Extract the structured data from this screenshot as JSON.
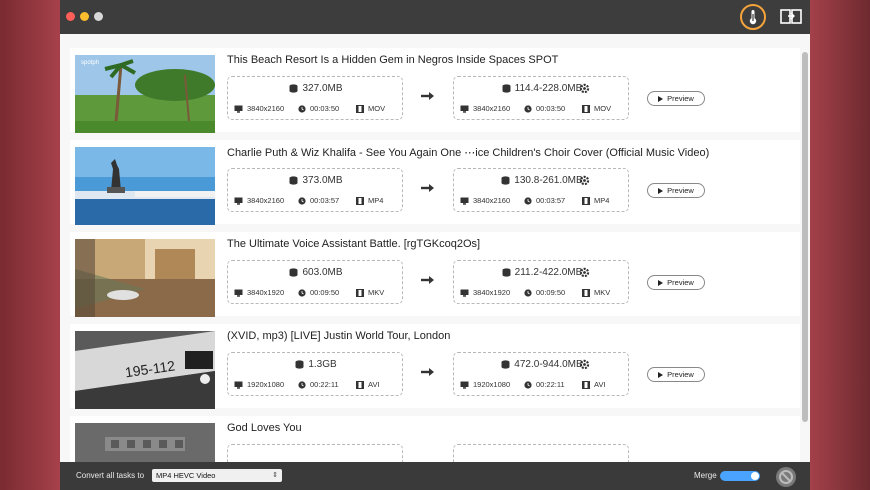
{
  "tasks": [
    {
      "title": "This Beach Resort Is a Hidden Gem in Negros   Inside Spaces   SPOT",
      "watermark": "spotph",
      "source": {
        "size": "327.0MB",
        "resolution": "3840x2160",
        "duration": "00:03:50",
        "format": "MOV"
      },
      "output": {
        "size": "114.4-228.0MB",
        "resolution": "3840x2160",
        "duration": "00:03:50",
        "format": "MOV"
      },
      "preview_label": "Preview"
    },
    {
      "title": "Charlie Puth & Wiz Khalifa - See You Again   One ⋯ice Children's Choir Cover (Official Music Video)",
      "source": {
        "size": "373.0MB",
        "resolution": "3840x2160",
        "duration": "00:03:57",
        "format": "MP4"
      },
      "output": {
        "size": "130.8-261.0MB",
        "resolution": "3840x2160",
        "duration": "00:03:57",
        "format": "MP4"
      },
      "preview_label": "Preview"
    },
    {
      "title": "The Ultimate Voice Assistant Battle. [rgTGKcoq2Os]",
      "source": {
        "size": "603.0MB",
        "resolution": "3840x1920",
        "duration": "00:09:50",
        "format": "MKV"
      },
      "output": {
        "size": "211.2-422.0MB",
        "resolution": "3840x1920",
        "duration": "00:09:50",
        "format": "MKV"
      },
      "preview_label": "Preview"
    },
    {
      "title": "(XVID, mp3) [LIVE] Justin World Tour, London",
      "thumb_text": "195-112",
      "source": {
        "size": "1.3GB",
        "resolution": "1920x1080",
        "duration": "00:22:11",
        "format": "AVI"
      },
      "output": {
        "size": "472.0-944.0MB",
        "resolution": "1920x1080",
        "duration": "00:22:11",
        "format": "AVI"
      },
      "preview_label": "Preview"
    },
    {
      "title": "God Loves You"
    }
  ],
  "bottom": {
    "convert_all_label": "Convert all tasks to",
    "format_selected": "MP4 HEVC Video",
    "merge_label": "Merge"
  },
  "colors": {
    "accent_toggle": "#4aa3ff",
    "highlight_ring": "#f4a43a"
  },
  "icons": [
    "thermometer-icon",
    "compress-icon",
    "database-icon",
    "monitor-icon",
    "clock-icon",
    "film-icon",
    "gear-icon",
    "arrow-right-icon",
    "play-icon",
    "convert-icon"
  ]
}
